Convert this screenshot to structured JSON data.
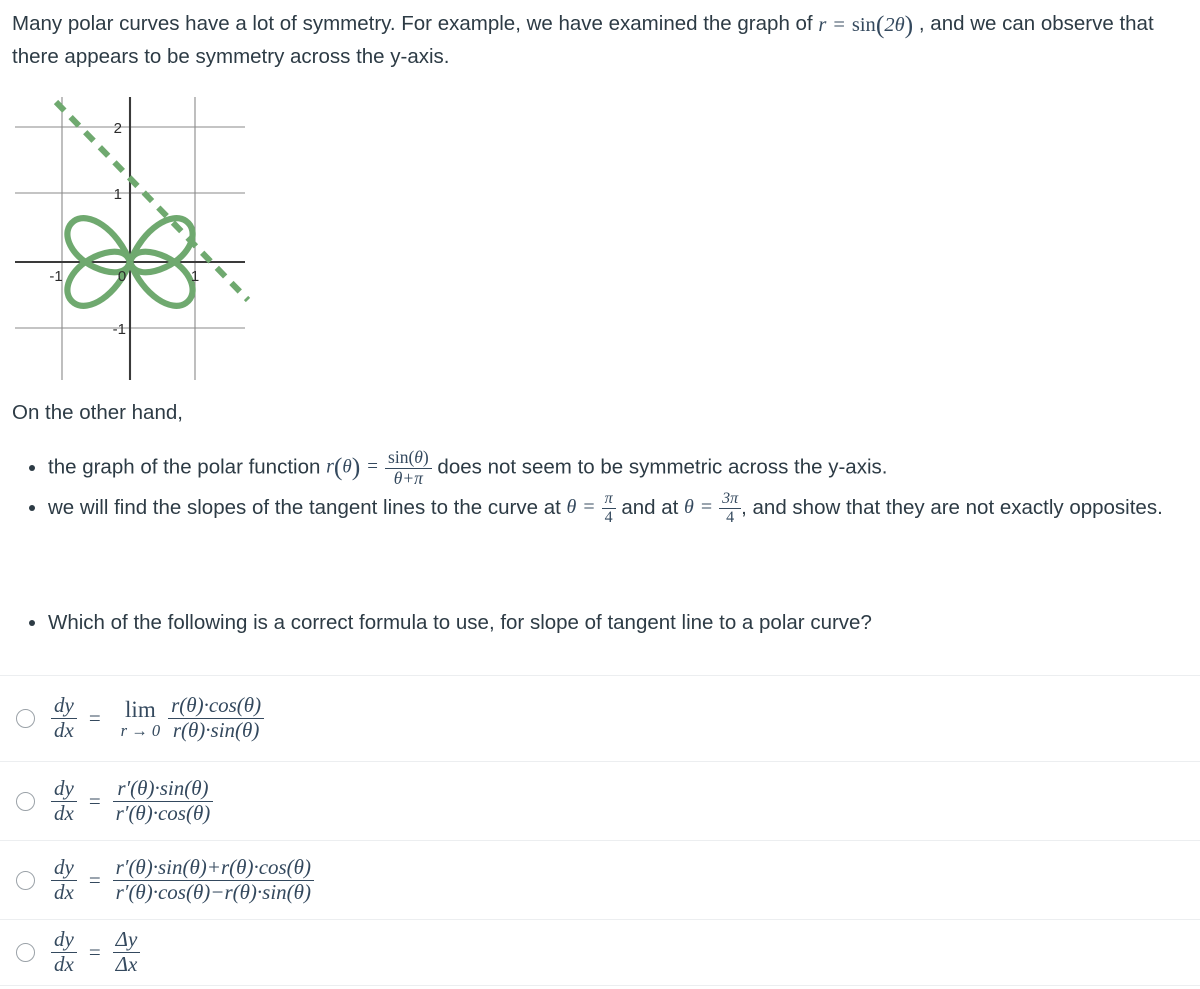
{
  "intro": {
    "part1": "Many polar curves have a lot of symmetry. For example, we have examined the graph of ",
    "equation": {
      "lhs": "r",
      "eq": "=",
      "rhs_fn": "sin",
      "rhs_arg": "2θ"
    },
    "part2": " , and we can observe that there appears to be symmetry across the y-axis."
  },
  "graph": {
    "caption": "polar rose curve r = sin(2 theta) with dashed tangent line",
    "x_ticks": [
      "-1",
      "0",
      "1"
    ],
    "y_ticks": [
      "2",
      "1",
      "-1"
    ],
    "curve_color": "#6fa96f",
    "dashed_line_color": "#6fa96f",
    "grid_color": "#8a8a8a",
    "axis_color": "#3a3a3a",
    "xlim": [
      -1.78,
      1.78
    ],
    "ylim": [
      -1.78,
      2.3
    ],
    "rose_equation": "r = sin(2θ)",
    "rose_petals": 4,
    "dashed_line_equation": "y = -x + 1.41"
  },
  "mid_text": "On the other hand,",
  "bullets": [
    {
      "id": "bullet-polar-function",
      "pre": "the graph of the polar function ",
      "fn_name": "r",
      "fn_arg": "θ",
      "eq": "=",
      "frac_num_fn": "sin",
      "frac_num_arg": "θ",
      "frac_den": "θ+π",
      "post": " does not seem to be symmetric across the y-axis."
    },
    {
      "id": "bullet-tangent-slopes",
      "pre": "we will find the slopes of the tangent lines to the curve at ",
      "theta1": "θ",
      "eq1": "=",
      "val1_num": "π",
      "val1_den": "4",
      "mid": " and at ",
      "theta2": "θ",
      "eq2": "=",
      "val2_num": "3π",
      "val2_den": "4",
      "post": ", and show that they are not exactly opposites."
    }
  ],
  "question": "Which of the following is a correct formula to use, for slope of tangent line to a polar curve?",
  "options": [
    {
      "id": "option-limit",
      "selected": false,
      "lhs_num": "dy",
      "lhs_den": "dx",
      "eq": "=",
      "kind": "limit",
      "lim_label": "lim",
      "lim_sub": "r → 0",
      "rhs_num": "r(θ)·cos(θ)",
      "rhs_den": "r(θ)·sin(θ)"
    },
    {
      "id": "option-rprime-ratio",
      "selected": false,
      "lhs_num": "dy",
      "lhs_den": "dx",
      "eq": "=",
      "kind": "fraction",
      "rhs_num": "r′(θ)·sin(θ)",
      "rhs_den": "r′(θ)·cos(θ)"
    },
    {
      "id": "option-product-rule",
      "selected": false,
      "lhs_num": "dy",
      "lhs_den": "dx",
      "eq": "=",
      "kind": "fraction",
      "rhs_num": "r′(θ)·sin(θ)+r(θ)·cos(θ)",
      "rhs_den": "r′(θ)·cos(θ)−r(θ)·sin(θ)"
    },
    {
      "id": "option-delta",
      "selected": false,
      "lhs_num": "dy",
      "lhs_den": "dx",
      "eq": "=",
      "kind": "fraction",
      "rhs_num": "Δy",
      "rhs_den": "Δx"
    }
  ],
  "colors": {
    "text": "#2d3b45",
    "math": "#34495e",
    "green": "#6fa96f",
    "separator": "#eceef0",
    "radio_border": "#9ba2a8"
  }
}
